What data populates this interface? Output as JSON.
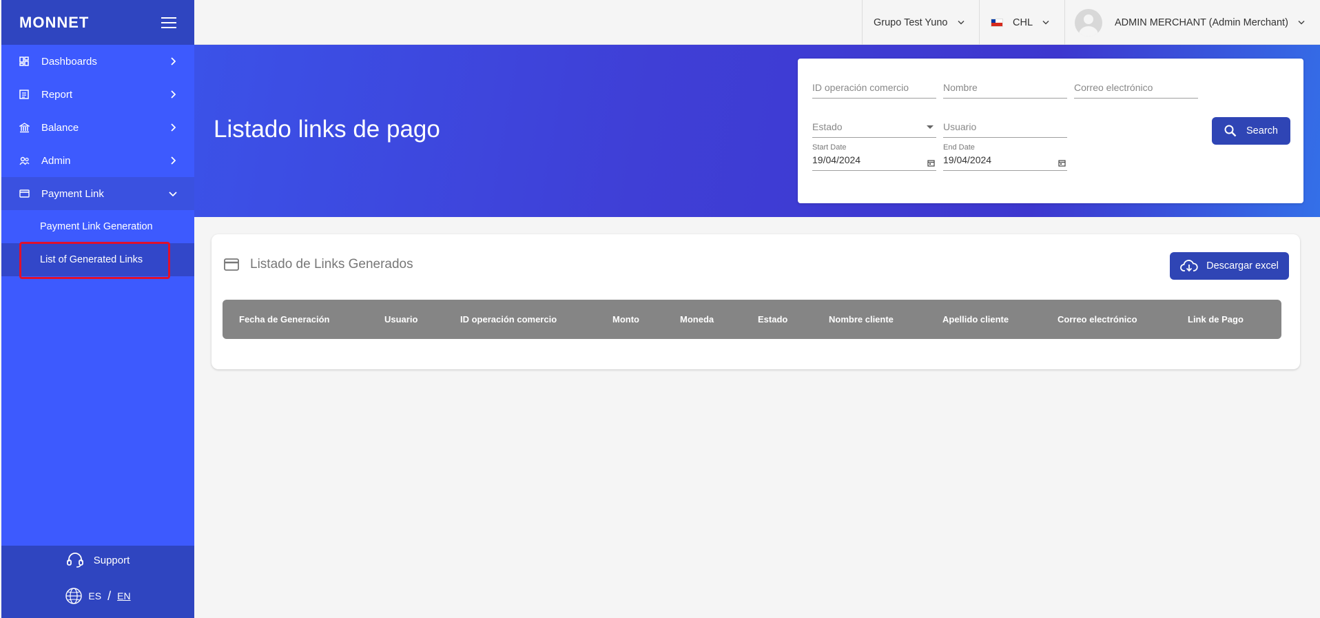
{
  "app": {
    "logo": "MONNET"
  },
  "sidebar": {
    "items": [
      {
        "label": "Dashboards",
        "icon": "dashboard-icon"
      },
      {
        "label": "Report",
        "icon": "report-icon"
      },
      {
        "label": "Balance",
        "icon": "bank-icon"
      },
      {
        "label": "Admin",
        "icon": "users-icon"
      },
      {
        "label": "Payment Link",
        "icon": "card-icon",
        "expanded": true
      }
    ],
    "sub_items": [
      {
        "label": "Payment Link Generation"
      },
      {
        "label": "List of Generated Links",
        "active": true
      }
    ],
    "support_label": "Support",
    "lang_es": "ES",
    "lang_sep": "/",
    "lang_en": "EN"
  },
  "topbar": {
    "group": "Grupo Test Yuno",
    "currency": "CHL",
    "user": "ADMIN MERCHANT (Admin Merchant)"
  },
  "hero": {
    "title": "Listado links de pago"
  },
  "filters": {
    "operation_id_placeholder": "ID operación comercio",
    "name_placeholder": "Nombre",
    "email_placeholder": "Correo electrónico",
    "status_placeholder": "Estado",
    "user_placeholder": "Usuario",
    "start_date_label": "Start Date",
    "start_date_value": "19/04/2024",
    "end_date_label": "End Date",
    "end_date_value": "19/04/2024",
    "search_label": "Search"
  },
  "list": {
    "title": "Listado de Links Generados",
    "excel_label": "Descargar excel",
    "columns": [
      "Fecha de Generación",
      "Usuario",
      "ID operación comercio",
      "Monto",
      "Moneda",
      "Estado",
      "Nombre cliente",
      "Apellido cliente",
      "Correo electrónico",
      "Link de Pago"
    ]
  },
  "colors": {
    "sidebar": "#3d5afe",
    "sidebar_dark": "#2f45c0",
    "button": "#2f45b5",
    "table_header": "#858585",
    "highlight": "#e0102c"
  }
}
